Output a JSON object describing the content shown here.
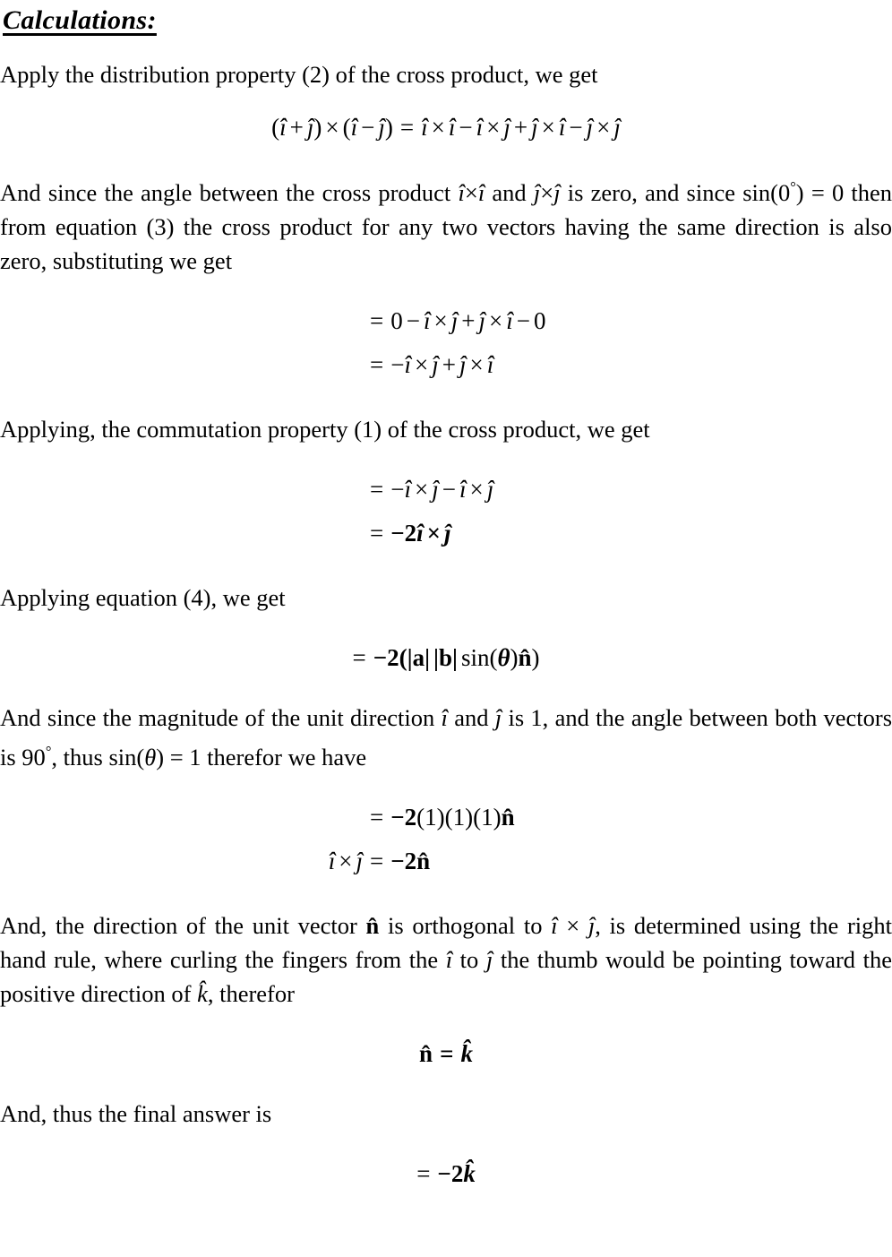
{
  "document": {
    "title": "Calculations:",
    "paragraphs": {
      "p1": "Apply the distribution property (2) of the cross product, we get",
      "p2": "And since the angle between the cross product î×î and ĵ×ĵ is zero, and since sin(0°) = 0 then from equation (3) the cross product for any two vectors having the same direction is also zero, substituting we get",
      "p3": "Applying, the commutation property (1) of the cross product, we get",
      "p4": "Applying equation (4), we get",
      "p5": "And since the magnitude of the unit direction î and ĵ is 1, and the angle between both vectors is 90°, thus sin(θ) = 1 therefor we have",
      "p6": "And, the direction of the unit vector n̂ is orthogonal to î × ĵ, is determined using the right hand rule, where curling the fingers from the î to ĵ the thumb would be pointing toward the positive direction of k̂, therefor",
      "p7": "And, thus the final answer is"
    },
    "paragraph_runs": {
      "p2_a": "And since the angle between the cross product",
      "p2_b": "and",
      "p2_c": "is zero, and since",
      "p2_d": "= 0 then from equation (3) the cross product for any two vectors having the same direction is also zero, substituting we get",
      "p5_a": "And since the magnitude of the unit direction",
      "p5_b": "and",
      "p5_c": "is 1, and the angle between both vectors is 90",
      "p5_d": ", thus",
      "p5_e": "= 1 therefor we have",
      "p6_a": "And, the direction of the unit vector",
      "p6_b": "is orthogonal to",
      "p6_c": ", is determined using the right hand rule, where curling the fingers from the",
      "p6_d": "to",
      "p6_e": "the thumb would be pointing toward the positive direction of",
      "p6_f": ", therefor"
    },
    "equations": {
      "eq1": {
        "id": "distribution-expansion",
        "latex": "(\\hat{\\imath}+\\hat{\\jmath})\\times(\\hat{\\imath}-\\hat{\\jmath}) = \\hat{\\imath}\\times\\hat{\\imath} - \\hat{\\imath}\\times\\hat{\\jmath} + \\hat{\\jmath}\\times\\hat{\\imath} - \\hat{\\jmath}\\times\\hat{\\jmath}",
        "text": "(î + ĵ) × (î − ĵ) = î × î − î × ĵ + ĵ × î − ĵ × ĵ"
      },
      "eq2": {
        "id": "substituted-zero-terms",
        "lines": [
          {
            "lhs": "=",
            "rhs": "0 − î × ĵ + ĵ × î − 0",
            "text": "= 0 − î × ĵ + ĵ × î − 0"
          },
          {
            "lhs": "=",
            "rhs": "−î × ĵ + ĵ × î",
            "text": "= −î × ĵ + ĵ × î"
          }
        ]
      },
      "eq3": {
        "id": "commutation-applied",
        "lines": [
          {
            "lhs": "=",
            "rhs": "−î × ĵ − î × ĵ",
            "text": "= −î × ĵ − î × ĵ"
          },
          {
            "lhs": "=",
            "rhs": "−2î × ĵ",
            "text": "= −2î × ĵ"
          }
        ]
      },
      "eq4": {
        "id": "magnitude-sine-form",
        "text": "= −2(|a| |b| sin(θ)n̂)"
      },
      "eq5": {
        "id": "numeric-substitution",
        "lines": [
          {
            "lhs": "",
            "rhs": "= −2(1)(1)(1)n̂",
            "text": "= −2(1)(1)(1)n̂"
          },
          {
            "lhs": "î × ĵ",
            "rhs": "= −2n̂",
            "text": "î × ĵ = −2n̂"
          }
        ]
      },
      "eq6": {
        "id": "normal-is-k-hat",
        "text": "n̂ = k̂"
      },
      "eq7": {
        "id": "final-answer",
        "text": "= −2k̂"
      }
    },
    "symbols": {
      "i_hat": "î",
      "j_hat": "ĵ",
      "k_hat": "k̂",
      "n_hat": "n̂",
      "theta": "θ",
      "times": "×",
      "minus": "−",
      "plus": "+",
      "equals": "=",
      "degree": "°",
      "zero": "0",
      "one": "1",
      "two": "2",
      "bold_a": "a",
      "bold_b": "b",
      "sin": "sin",
      "bar": "|",
      "lparen": "(",
      "rparen": ")"
    },
    "colors": {
      "text": "#000000",
      "background": "#ffffff"
    }
  }
}
